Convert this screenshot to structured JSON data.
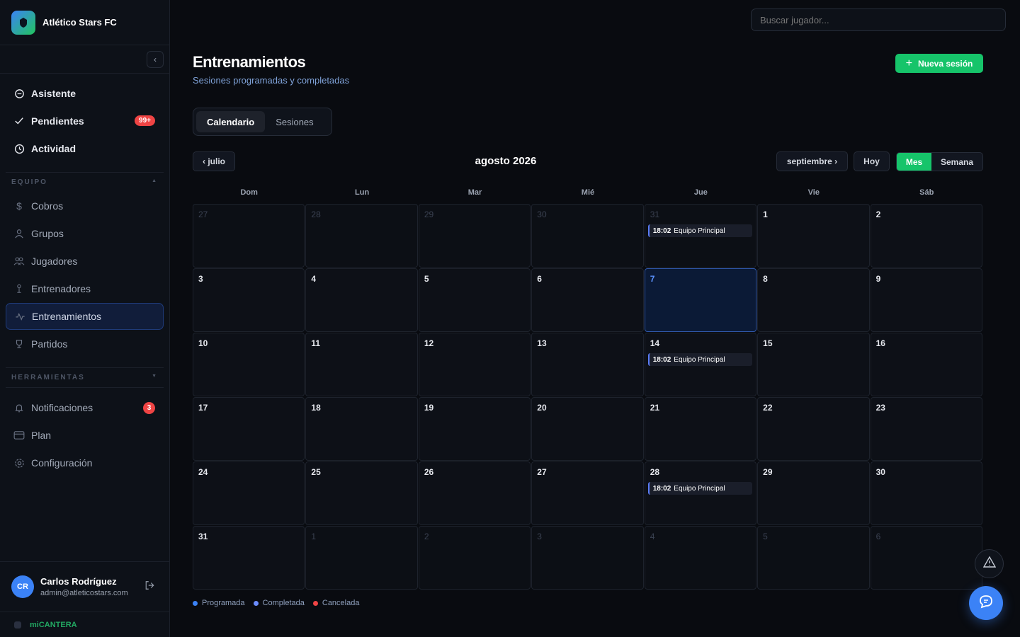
{
  "sidebar": {
    "brand": {
      "name": "Atlético Stars FC"
    },
    "nav_top": [
      {
        "label": "Asistente",
        "icon": "chat-icon"
      },
      {
        "label": "Pendientes",
        "icon": "check-icon",
        "badge": "99+"
      },
      {
        "label": "Actividad",
        "icon": "clock-icon"
      }
    ],
    "section_equipo": "EQUIPO",
    "nav_equipo": [
      {
        "label": "Cobros",
        "icon": "dollar-icon"
      },
      {
        "label": "Grupos",
        "icon": "user-icon"
      },
      {
        "label": "Jugadores",
        "icon": "users-icon"
      },
      {
        "label": "Entrenadores",
        "icon": "coach-icon"
      },
      {
        "label": "Entrenamientos",
        "icon": "activity-icon",
        "active": true
      },
      {
        "label": "Partidos",
        "icon": "trophy-icon"
      }
    ],
    "section_herramientas": "HERRAMIENTAS",
    "nav_tools": [
      {
        "label": "Notificaciones",
        "icon": "bell-icon",
        "badge": "3"
      },
      {
        "label": "Plan",
        "icon": "card-icon"
      },
      {
        "label": "Configuración",
        "icon": "gear-icon"
      }
    ],
    "user": {
      "initials": "CR",
      "name": "Carlos Rodríguez",
      "email": "admin@atleticostars.com"
    },
    "footer_brand": "miCANTERA"
  },
  "search": {
    "placeholder": "Buscar jugador..."
  },
  "page": {
    "title": "Entrenamientos",
    "subtitle": "Sesiones programadas y completadas",
    "new_button": "Nueva sesión"
  },
  "tabs": [
    "Calendario",
    "Sesiones"
  ],
  "calendar": {
    "prev_label": "‹ julio",
    "next_label": "septiembre ›",
    "today_label": "Hoy",
    "month_title": "agosto 2026",
    "view_month": "Mes",
    "view_week": "Semana",
    "weekdays": [
      "Dom",
      "Lun",
      "Mar",
      "Mié",
      "Jue",
      "Vie",
      "Sáb"
    ],
    "days": [
      {
        "n": "27",
        "other": true
      },
      {
        "n": "28",
        "other": true
      },
      {
        "n": "29",
        "other": true
      },
      {
        "n": "30",
        "other": true
      },
      {
        "n": "31",
        "other": true,
        "event": {
          "time": "18:02",
          "name": "Equipo Principal"
        }
      },
      {
        "n": "1"
      },
      {
        "n": "2"
      },
      {
        "n": "3"
      },
      {
        "n": "4"
      },
      {
        "n": "5"
      },
      {
        "n": "6"
      },
      {
        "n": "7",
        "today": true
      },
      {
        "n": "8"
      },
      {
        "n": "9"
      },
      {
        "n": "10"
      },
      {
        "n": "11"
      },
      {
        "n": "12"
      },
      {
        "n": "13"
      },
      {
        "n": "14",
        "event": {
          "time": "18:02",
          "name": "Equipo Principal"
        }
      },
      {
        "n": "15"
      },
      {
        "n": "16"
      },
      {
        "n": "17"
      },
      {
        "n": "18"
      },
      {
        "n": "19"
      },
      {
        "n": "20"
      },
      {
        "n": "21"
      },
      {
        "n": "22"
      },
      {
        "n": "23"
      },
      {
        "n": "24"
      },
      {
        "n": "25"
      },
      {
        "n": "26"
      },
      {
        "n": "27"
      },
      {
        "n": "28",
        "event": {
          "time": "18:02",
          "name": "Equipo Principal"
        }
      },
      {
        "n": "29"
      },
      {
        "n": "30"
      },
      {
        "n": "31"
      },
      {
        "n": "1",
        "other": true
      },
      {
        "n": "2",
        "other": true
      },
      {
        "n": "3",
        "other": true
      },
      {
        "n": "4",
        "other": true
      },
      {
        "n": "5",
        "other": true
      },
      {
        "n": "6",
        "other": true
      }
    ]
  },
  "legend": [
    {
      "label": "Programada",
      "color": "#3b82f6"
    },
    {
      "label": "Completada",
      "color": "#6b8cff"
    },
    {
      "label": "Cancelada",
      "color": "#ef4444"
    }
  ],
  "colors": {
    "accent": "#16c46a",
    "primary": "#3b82f6",
    "danger": "#ef4444"
  }
}
